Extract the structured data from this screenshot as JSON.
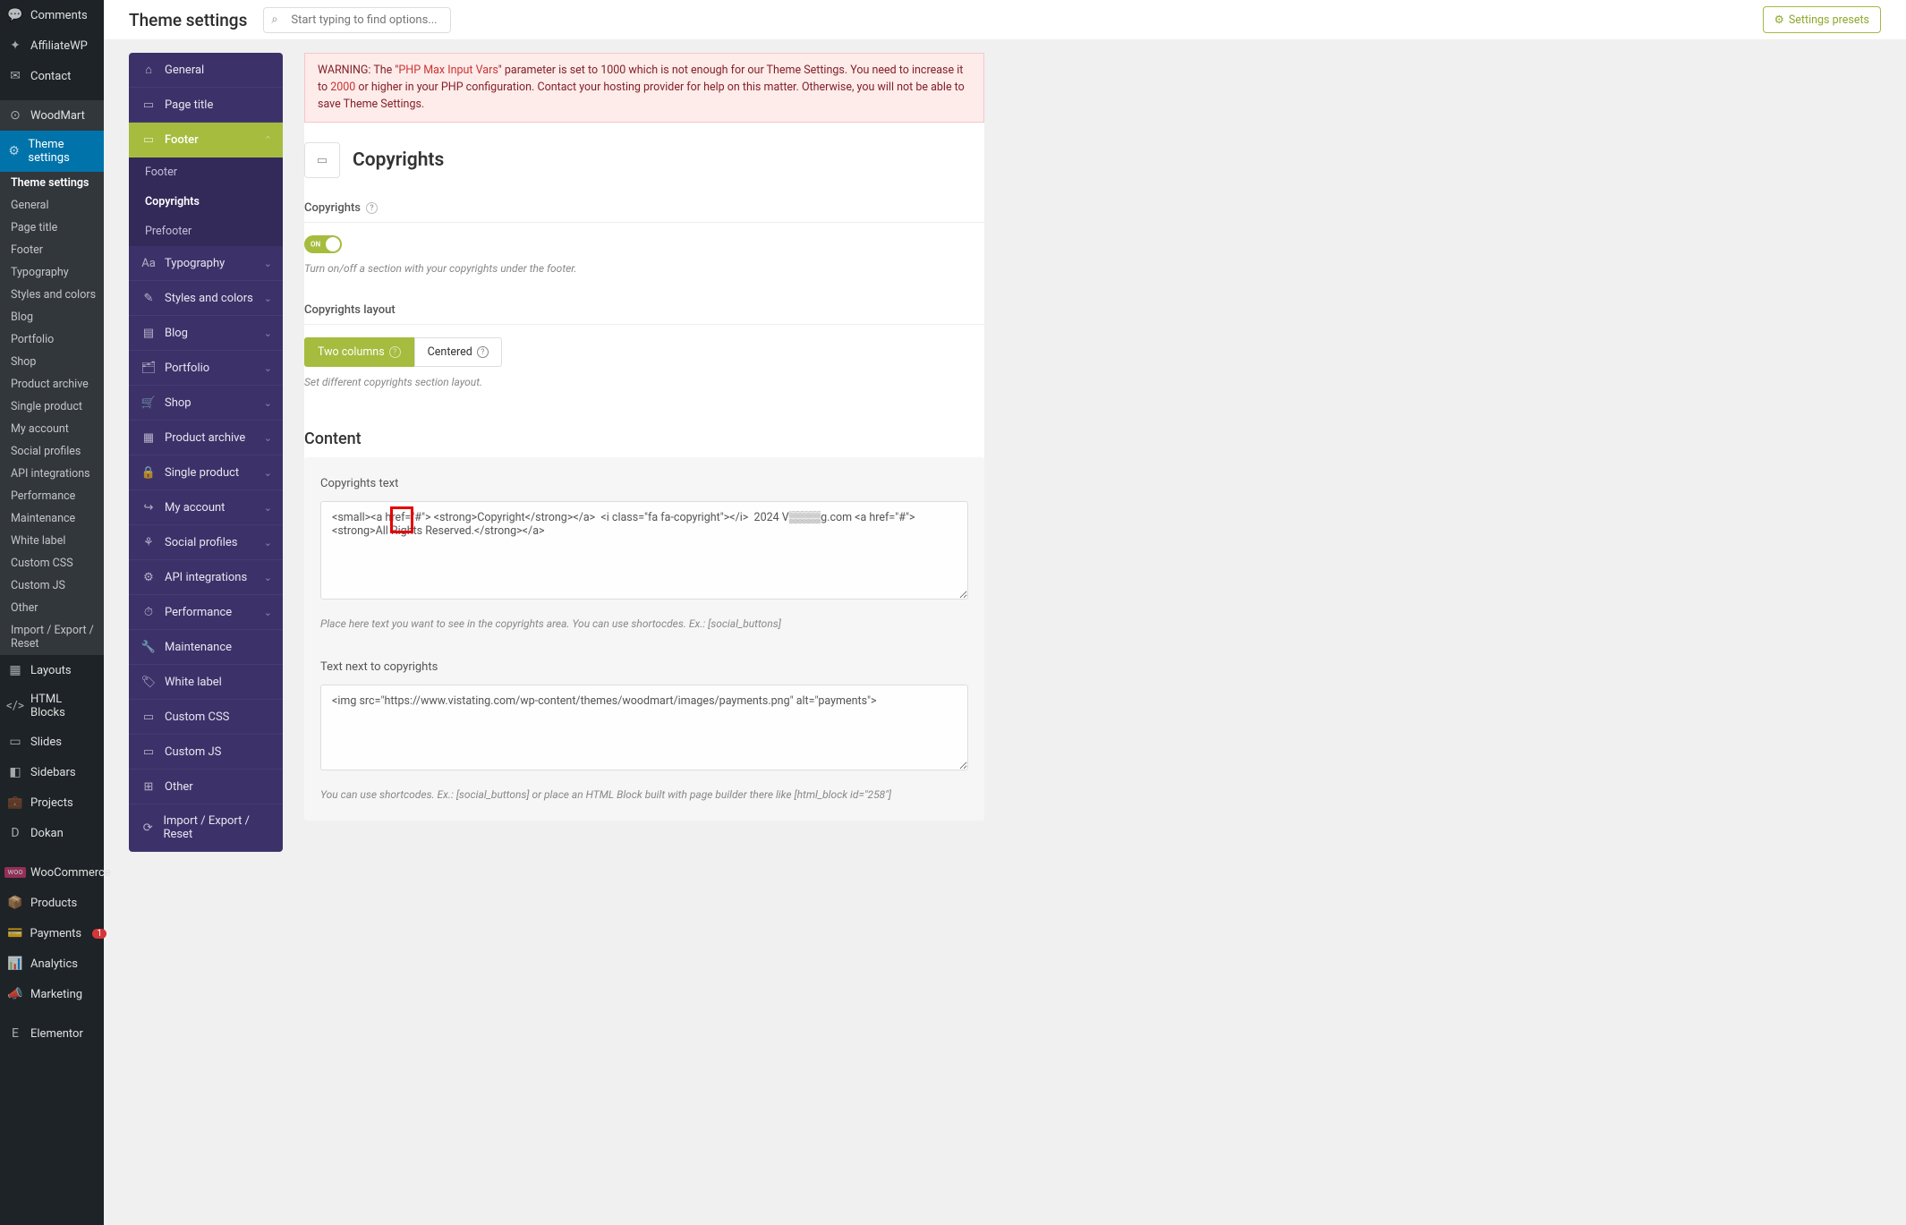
{
  "topbar": {
    "title": "Theme settings",
    "search_placeholder": "Start typing to find options...",
    "presets_label": "Settings presets"
  },
  "wp_menu": {
    "comments": "Comments",
    "affiliatewp": "AffiliateWP",
    "contact": "Contact",
    "woodmart": "WoodMart",
    "theme_settings": "Theme settings",
    "subs": {
      "theme_settings": "Theme settings",
      "general": "General",
      "page_title": "Page title",
      "footer": "Footer",
      "typography": "Typography",
      "styles": "Styles and colors",
      "blog": "Blog",
      "portfolio": "Portfolio",
      "shop": "Shop",
      "product_archive": "Product archive",
      "single_product": "Single product",
      "my_account": "My account",
      "social": "Social profiles",
      "api": "API integrations",
      "performance": "Performance",
      "maintenance": "Maintenance",
      "white_label": "White label",
      "custom_css": "Custom CSS",
      "custom_js": "Custom JS",
      "other": "Other",
      "import_export": "Import / Export / Reset"
    },
    "layouts": "Layouts",
    "html_blocks": "HTML Blocks",
    "slides": "Slides",
    "sidebars": "Sidebars",
    "projects": "Projects",
    "dokan": "Dokan",
    "woocommerce": "WooCommerce",
    "products": "Products",
    "payments": "Payments",
    "payments_badge": "1",
    "analytics": "Analytics",
    "marketing": "Marketing",
    "elementor": "Elementor"
  },
  "settings_nav": {
    "general": "General",
    "page_title": "Page title",
    "footer": "Footer",
    "footer_sub": "Footer",
    "copyrights_sub": "Copyrights",
    "prefooter_sub": "Prefooter",
    "typography": "Typography",
    "styles": "Styles and colors",
    "blog": "Blog",
    "portfolio": "Portfolio",
    "shop": "Shop",
    "product_archive": "Product archive",
    "single_product": "Single product",
    "my_account": "My account",
    "social": "Social profiles",
    "api": "API integrations",
    "performance": "Performance",
    "maintenance": "Maintenance",
    "white_label": "White label",
    "custom_css": "Custom CSS",
    "custom_js": "Custom JS",
    "other": "Other",
    "import_export": "Import / Export / Reset"
  },
  "warning": {
    "prefix": "WARNING: The \"",
    "param": "PHP Max Input Vars",
    "mid": "\" parameter is set to 1000 which is not enough for our Theme Settings. You need to increase it to ",
    "num": "2000",
    "suffix": " or higher in your PHP configuration. Contact your hosting provider for help on this matter. Otherwise, you will not be able to save Theme Settings."
  },
  "page": {
    "header": "Copyrights",
    "copyrights": {
      "label": "Copyrights",
      "toggle_state": "ON",
      "hint": "Turn on/off a section with your copyrights under the footer."
    },
    "layout": {
      "label": "Copyrights layout",
      "opt1": "Two columns",
      "opt2": "Centered",
      "hint": "Set different copyrights section layout."
    },
    "content_title": "Content",
    "copyrights_text": {
      "label": "Copyrights text",
      "value": "<small><a href=\"#\"> <strong>Copyright</strong></a>  <i class=\"fa fa-copyright\"></i>  2024 V▒▒▒▒g.com <a href=\"#\"><strong>All Rights Reserved.</strong></a>",
      "hint": "Place here text you want to see in the copyrights area. You can use shortocdes. Ex.: [social_buttons]"
    },
    "text_next": {
      "label": "Text next to copyrights",
      "value": "<img src=\"https://www.vistating.com/wp-content/themes/woodmart/images/payments.png\" alt=\"payments\">",
      "hint": "You can use shortcodes. Ex.: [social_buttons] or place an HTML Block built with page builder there like [html_block id=\"258\"]"
    }
  }
}
